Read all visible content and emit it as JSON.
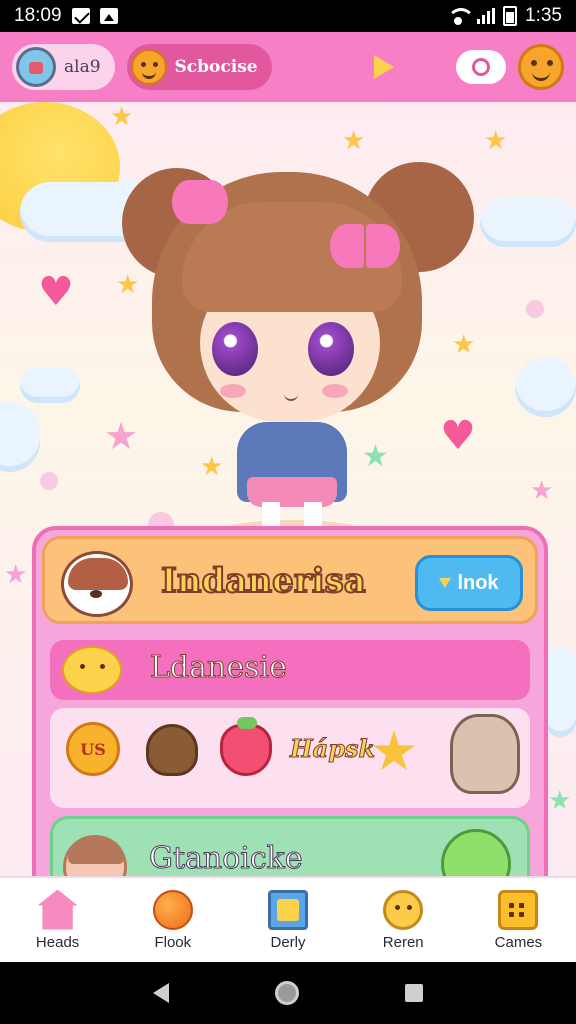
{
  "status_bar": {
    "time": "18:09",
    "battery_text": "1:35"
  },
  "top_bar": {
    "profile_label": "ala9",
    "school_label": "Scbocise"
  },
  "panel": {
    "header_title": "Indanerisa",
    "header_button_label": "lnok",
    "sub_title": "Ldanesie",
    "coin_text": "US",
    "items_label": "Hápsk",
    "bottom_title": "Gtanoicke"
  },
  "bottom_nav": {
    "items": [
      {
        "label": "Heads",
        "icon": "house-icon"
      },
      {
        "label": "Flook",
        "icon": "orange-icon"
      },
      {
        "label": "Derly",
        "icon": "book-icon"
      },
      {
        "label": "Reren",
        "icon": "lion-icon"
      },
      {
        "label": "Cames",
        "icon": "box-icon"
      }
    ]
  },
  "colors": {
    "top_bar": "#f77fc6",
    "panel": "#f7a6db",
    "header_row": "#fcc27a",
    "button": "#4fb9f2",
    "bottom_row": "#9ee1b4"
  }
}
